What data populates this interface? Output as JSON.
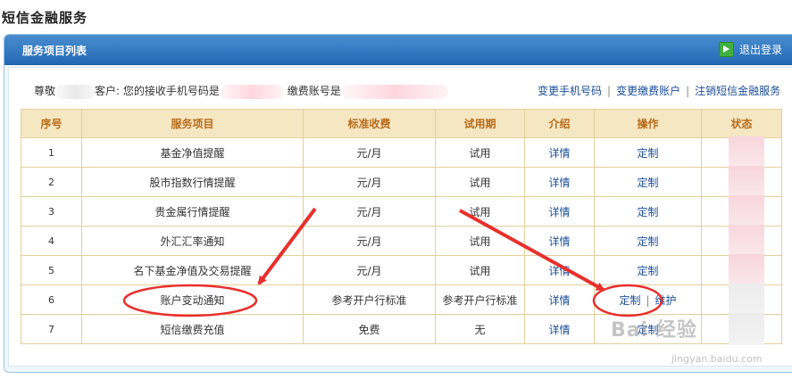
{
  "page": {
    "title": "短信金融服务"
  },
  "panel": {
    "title": "服务项目列表",
    "logout_label": "退出登录"
  },
  "info": {
    "greeting": "尊敬",
    "customer_suffix": "客户: 您的接收手机号码是",
    "account_label": "缴费账号是"
  },
  "links": [
    {
      "label": "变更手机号码"
    },
    {
      "label": "变更缴费账户"
    },
    {
      "label": "注销短信金融服务"
    }
  ],
  "table": {
    "headers": [
      "序号",
      "服务项目",
      "标准收费",
      "试用期",
      "介绍",
      "操作",
      "状态"
    ],
    "rows": [
      {
        "no": "1",
        "item": "基金净值提醒",
        "fee": "元/月",
        "trial": "试用",
        "intro": "详情",
        "action": "定制",
        "extra_action": ""
      },
      {
        "no": "2",
        "item": "股市指数行情提醒",
        "fee": "元/月",
        "trial": "试用",
        "intro": "详情",
        "action": "定制",
        "extra_action": ""
      },
      {
        "no": "3",
        "item": "贵金属行情提醒",
        "fee": "元/月",
        "trial": "试用",
        "intro": "详情",
        "action": "定制",
        "extra_action": ""
      },
      {
        "no": "4",
        "item": "外汇汇率通知",
        "fee": "元/月",
        "trial": "试用",
        "intro": "详情",
        "action": "定制",
        "extra_action": ""
      },
      {
        "no": "5",
        "item": "名下基金净值及交易提醒",
        "fee": "元/月",
        "trial": "试用",
        "intro": "详情",
        "action": "定制",
        "extra_action": ""
      },
      {
        "no": "6",
        "item": "账户变动通知",
        "fee": "参考开户行标准",
        "trial": "参考开户行标准",
        "intro": "详情",
        "action": "定制",
        "extra_action": "维护"
      },
      {
        "no": "7",
        "item": "短信缴费充值",
        "fee": "免费",
        "trial": "无",
        "intro": "详情",
        "action": "定制",
        "extra_action": ""
      }
    ]
  },
  "watermark": {
    "text": "Bai 经验",
    "url": "jingyan.baidu.com"
  },
  "colors": {
    "header_blue": "#2f77c2",
    "table_header_bg": "#f6e7c3",
    "table_header_text": "#b86b1a",
    "link": "#1a4d97",
    "annotation_red": "#e8302d"
  }
}
